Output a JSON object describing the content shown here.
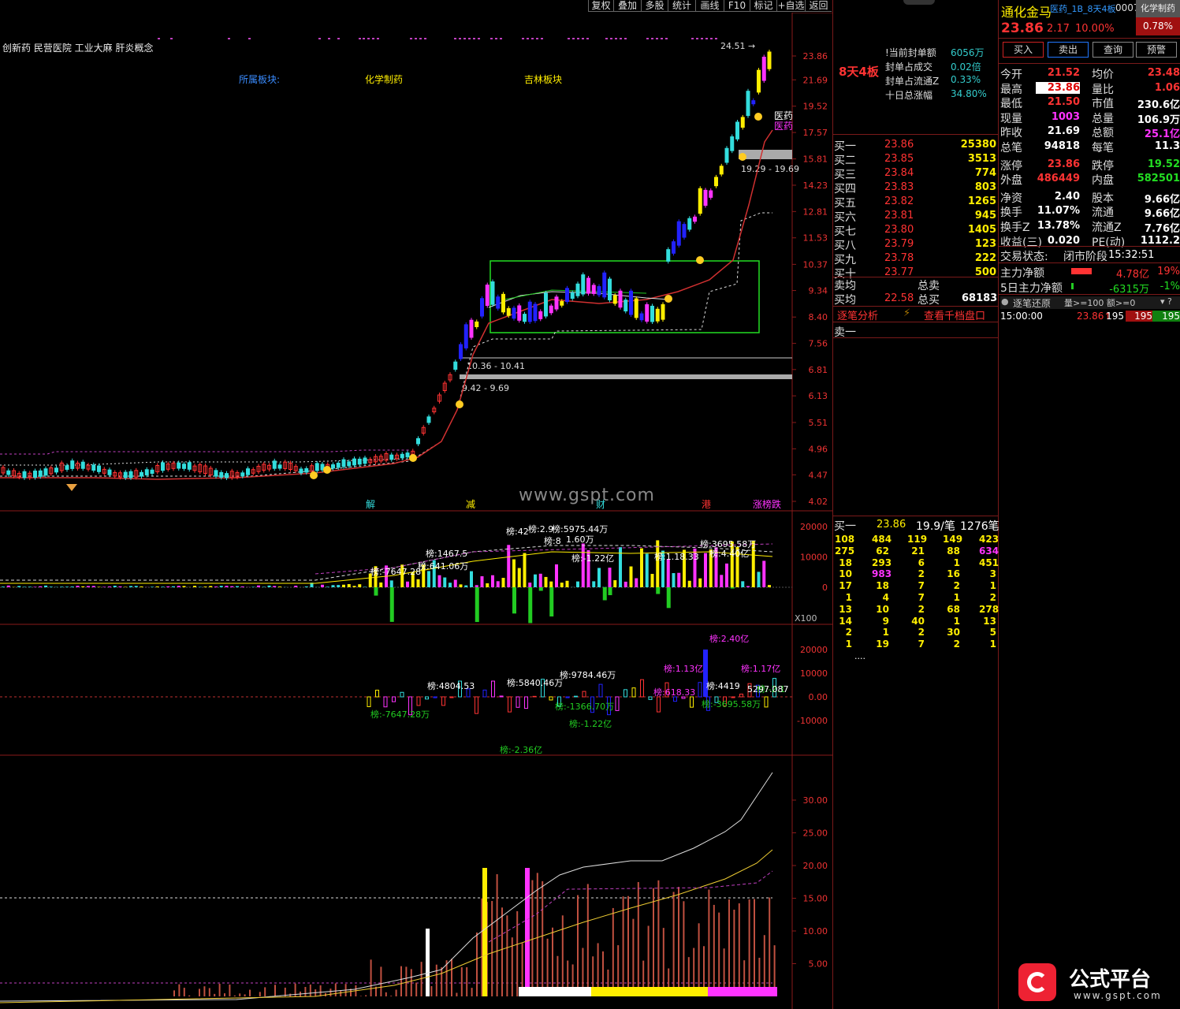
{
  "toolbar": {
    "items": [
      "复权",
      "叠加",
      "多股",
      "统计",
      "画线",
      "F10",
      "标记",
      "+自选",
      "返回"
    ]
  },
  "chart": {
    "concept_tags": "创新药 民营医院 工业大麻 肝炎概念",
    "sectors": [
      "所属板块:",
      "化学制药",
      "吉林板块"
    ],
    "price_axis": [
      "23.86",
      "21.69",
      "19.52",
      "17.57",
      "15.81",
      "14.23",
      "12.81",
      "11.53",
      "10.37",
      "9.34",
      "8.40",
      "7.56",
      "6.81",
      "6.13",
      "5.51",
      "4.96",
      "4.47",
      "4.02"
    ],
    "high_label": "24.51",
    "tag_right": "医药",
    "zones": [
      "19.29 - 19.69",
      "10.36 - 10.41",
      "9.42 - 9.69"
    ],
    "markers": [
      "解",
      "减",
      "财",
      "港",
      "涨榜跌"
    ],
    "watermark": "www.gspt.com",
    "sub1_axis": [
      "20000",
      "10000",
      "0"
    ],
    "sub1_unit": "X100",
    "sub1_labels": [
      "榜:-7647.28",
      "榜:1467.5",
      "榜:641.06万",
      "榜:-1.22亿",
      "榜:3695.58万",
      "榜:4.40亿",
      "榜:1.18.33",
      "榜:42",
      "榜:2.9",
      "榜:5975.44万",
      "榜:8",
      "1.60万"
    ],
    "sub2_axis": [
      "20000",
      "10000",
      "0.00",
      "-10000"
    ],
    "sub2_labels": [
      "榜:-7647.28万",
      "榜:4804.53",
      "榜:5840.46万",
      "榜:9784.46万",
      "榜:1.13亿",
      "榜:1.17亿",
      "榜:4419",
      "榜:2.40亿",
      "榜:-3695.58万",
      "榜:-1366.70万",
      "榜:-1.22亿",
      "榜:-2.36亿",
      "榜:618.33",
      "榜:-2.1",
      "5297.087"
    ],
    "sub3_axis": [
      "30.00",
      "25.00",
      "20.00",
      "15.00",
      "10.00",
      "5.00"
    ]
  },
  "quote": {
    "name": "通化金马",
    "tag": "医药_1B_8天4板",
    "code": "0007",
    "industry": "化学制药",
    "price": "23.86",
    "change": "2.17",
    "pct": "10.00%",
    "pct2": "0.78%",
    "buttons": [
      "买入",
      "卖出",
      "查询",
      "预警"
    ],
    "board_count": "8天4板",
    "seal": [
      {
        "k": "当前封单额",
        "v": "6056万"
      },
      {
        "k": "封单占成交",
        "v": "0.02倍"
      },
      {
        "k": "封单占流通Z",
        "v": "0.33%"
      },
      {
        "k": "十日总涨幅",
        "v": "34.80%"
      }
    ],
    "stats": [
      {
        "k1": "今开",
        "v1": "21.52",
        "k2": "均价",
        "v2": "23.48"
      },
      {
        "k1": "最高",
        "v1": "23.86",
        "k2": "量比",
        "v2": "1.06"
      },
      {
        "k1": "最低",
        "v1": "21.50",
        "k2": "市值",
        "v2": "230.6亿"
      },
      {
        "k1": "现量",
        "v1": "1003",
        "k2": "总量",
        "v2": "106.9万"
      },
      {
        "k1": "昨收",
        "v1": "21.69",
        "k2": "总额",
        "v2": "25.1亿"
      },
      {
        "k1": "总笔",
        "v1": "94818",
        "k2": "每笔",
        "v2": "11.3"
      },
      {
        "k1": "涨停",
        "v1": "23.86",
        "k2": "跌停",
        "v2": "19.52"
      },
      {
        "k1": "外盘",
        "v1": "486449",
        "k2": "内盘",
        "v2": "582501"
      },
      {
        "k1": "净资",
        "v1": "2.40",
        "k2": "股本",
        "v2": "9.66亿"
      },
      {
        "k1": "换手",
        "v1": "11.07%",
        "k2": "流通",
        "v2": "9.66亿"
      },
      {
        "k1": "换手Z",
        "v1": "13.78%",
        "k2": "流通Z",
        "v2": "7.76亿"
      },
      {
        "k1": "收益(三)",
        "v1": "0.020",
        "k2": "PE(动)",
        "v2": "1112.2"
      }
    ],
    "trade_status_label": "交易状态:",
    "trade_status": "闭市阶段",
    "trade_time": "15:32:51",
    "flow": [
      {
        "k": "主力净额",
        "v": "4.78亿",
        "p": "19%"
      },
      {
        "k": "5日主力净额",
        "v": "-6315万",
        "p": "-1%"
      }
    ],
    "tick_header": "逐笔还原",
    "tick_filter": "量>=100 额>=0",
    "ticks": [
      {
        "t": "15:00:00",
        "p": "23.86",
        "v": "195",
        "a": "195",
        "b": "195"
      }
    ],
    "bids": [
      {
        "k": "买一",
        "p": "23.86",
        "v": "25380"
      },
      {
        "k": "买二",
        "p": "23.85",
        "v": "3513"
      },
      {
        "k": "买三",
        "p": "23.84",
        "v": "774"
      },
      {
        "k": "买四",
        "p": "23.83",
        "v": "803"
      },
      {
        "k": "买五",
        "p": "23.82",
        "v": "1265"
      },
      {
        "k": "买六",
        "p": "23.81",
        "v": "945"
      },
      {
        "k": "买七",
        "p": "23.80",
        "v": "1405"
      },
      {
        "k": "买八",
        "p": "23.79",
        "v": "123"
      },
      {
        "k": "买九",
        "p": "23.78",
        "v": "222"
      },
      {
        "k": "买十",
        "p": "23.77",
        "v": "500"
      }
    ],
    "avg_sell": "卖均",
    "total_sell": "总卖",
    "avg_buy": "买均",
    "avg_buy_val": "22.58",
    "total_buy": "总买",
    "total_buy_val": "68183",
    "tabs": [
      "逐笔分析",
      "查看千档盘口"
    ],
    "sell_one": "卖一",
    "queue_head": {
      "k": "买一",
      "p": "23.86",
      "n": "19.9/笔",
      "c": "1276笔"
    },
    "queue": [
      [
        "108",
        "484",
        "119",
        "149",
        "423"
      ],
      [
        "275",
        "62",
        "21",
        "88",
        "634"
      ],
      [
        "18",
        "293",
        "6",
        "1",
        "451"
      ],
      [
        "10",
        "983",
        "2",
        "16",
        "3"
      ],
      [
        "17",
        "18",
        "7",
        "2",
        "1"
      ],
      [
        "1",
        "4",
        "7",
        "1",
        "2"
      ],
      [
        "13",
        "10",
        "2",
        "68",
        "278"
      ],
      [
        "14",
        "9",
        "40",
        "1",
        "13"
      ],
      [
        "2",
        "1",
        "2",
        "30",
        "5"
      ],
      [
        "1",
        "19",
        "7",
        "2",
        "1"
      ]
    ],
    "queue_more": "....",
    "logo_text": "公式平台",
    "logo_url": "www.gspt.com"
  }
}
